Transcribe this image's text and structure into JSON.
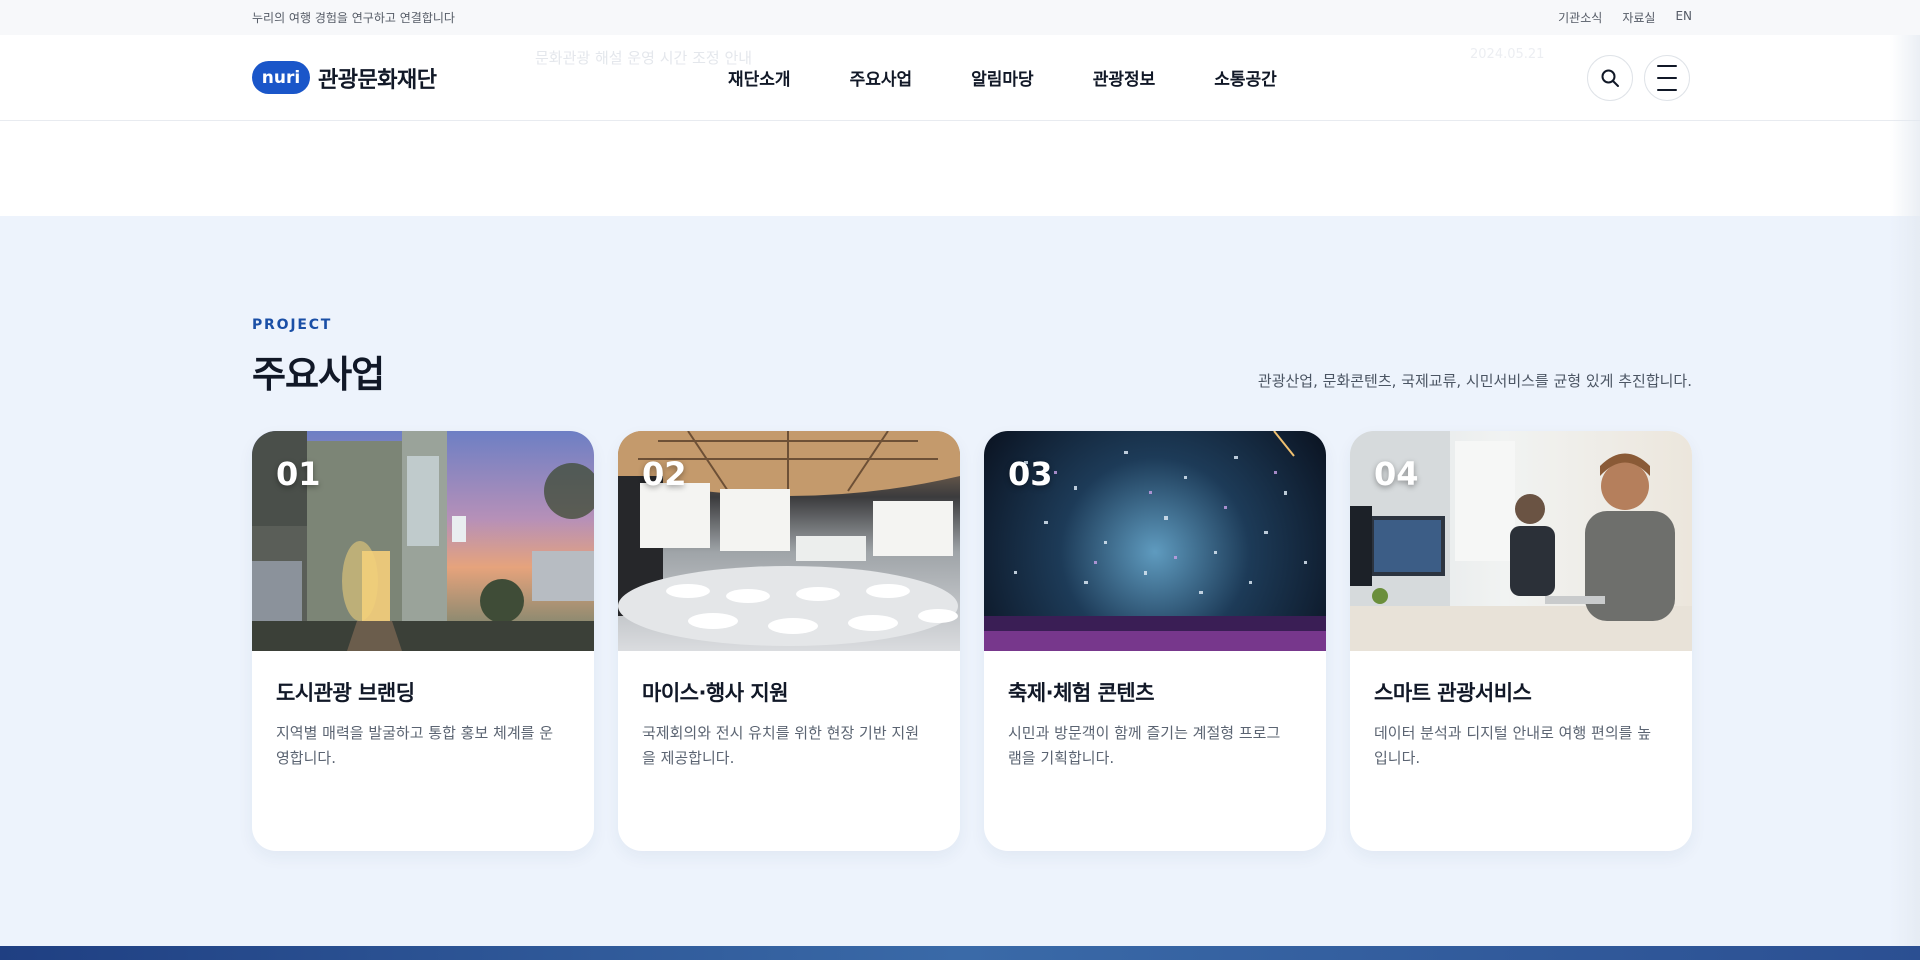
{
  "utility": {
    "tagline": "누리의 여행 경험을 연구하고 연결합니다",
    "links": [
      "기관소식",
      "자료실",
      "EN"
    ]
  },
  "header": {
    "ghost_notice": "문화관광 해설 운영 시간 조정 안내",
    "ghost_date": "2024.05.21",
    "logo_badge": "nuri",
    "logo_text": "관광문화재단",
    "nav": [
      "재단소개",
      "주요사업",
      "알림마당",
      "관광정보",
      "소통공간"
    ],
    "icons": {
      "search": "search-icon",
      "menu": "hamburger-menu-icon"
    }
  },
  "section": {
    "eyebrow": "PROJECT",
    "title": "주요사업",
    "description": "관광산업, 문화콘텐츠, 국제교류, 시민서비스를 균형 있게 추진합니다.",
    "cards": [
      {
        "num": "01",
        "title": "도시관광 브랜딩",
        "text": "지역별 매력을 발굴하고 통합 홍보 체계를 운영합니다.",
        "image": "house-at-dusk-photo"
      },
      {
        "num": "02",
        "title": "마이스·행사 지원",
        "text": "국제회의와 전시 유치를 위한 현장 기반 지원을 제공합니다.",
        "image": "conference-hall-photo"
      },
      {
        "num": "03",
        "title": "축제·체험 콘텐츠",
        "text": "시민과 방문객이 함께 즐기는 계절형 프로그램을 기획합니다.",
        "image": "festival-confetti-photo"
      },
      {
        "num": "04",
        "title": "스마트 관광서비스",
        "text": "데이터 분석과 디지털 안내로 여행 편의를 높입니다.",
        "image": "office-workers-photo"
      }
    ]
  },
  "colors": {
    "brand": "#1a56c9",
    "eyebrow": "#1a4fa6",
    "section_bg": "#edf3fc"
  }
}
